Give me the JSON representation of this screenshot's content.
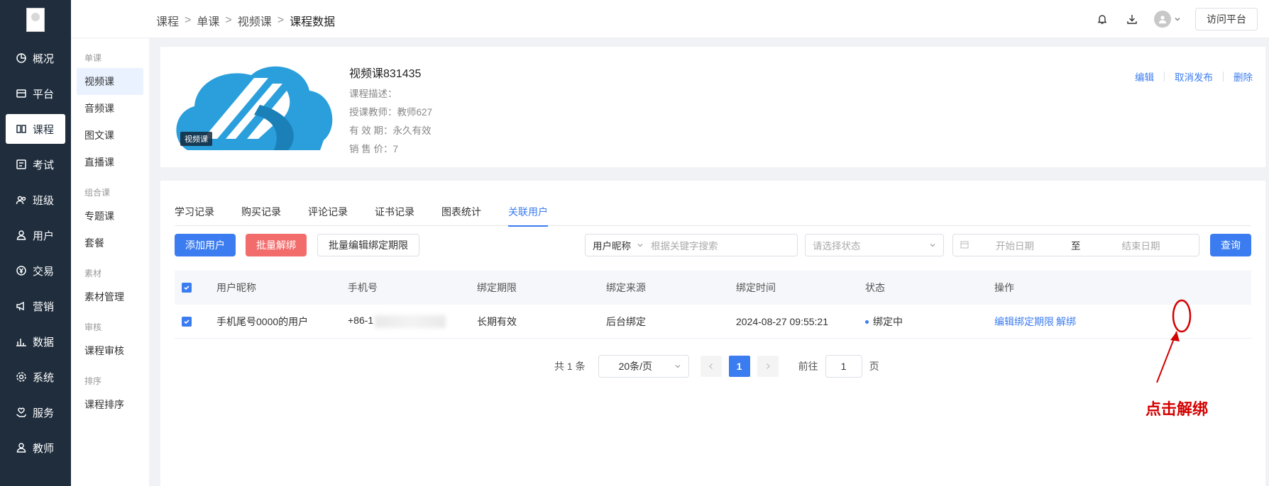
{
  "nav": {
    "items": [
      {
        "label": "概况"
      },
      {
        "label": "平台"
      },
      {
        "label": "课程"
      },
      {
        "label": "考试"
      },
      {
        "label": "班级"
      },
      {
        "label": "用户"
      },
      {
        "label": "交易"
      },
      {
        "label": "营销"
      },
      {
        "label": "数据"
      },
      {
        "label": "系统"
      },
      {
        "label": "服务"
      },
      {
        "label": "教师"
      }
    ]
  },
  "subnav": {
    "groups": [
      {
        "title": "单课",
        "items": [
          "视频课",
          "音频课",
          "图文课",
          "直播课"
        ]
      },
      {
        "title": "组合课",
        "items": [
          "专题课",
          "套餐"
        ]
      },
      {
        "title": "素材",
        "items": [
          "素材管理"
        ]
      },
      {
        "title": "审核",
        "items": [
          "课程审核"
        ]
      },
      {
        "title": "排序",
        "items": [
          "课程排序"
        ]
      }
    ]
  },
  "breadcrumb": [
    "课程",
    "单课",
    "视频课",
    "课程数据"
  ],
  "topbar": {
    "visit_label": "访问平台"
  },
  "course": {
    "cover_tag": "视频课",
    "title": "视频课831435",
    "desc": "课程描述：",
    "teacher": "授课教师：教师627",
    "validity": "有 效 期：永久有效",
    "price": "销 售 价：7",
    "actions": {
      "edit": "编辑",
      "unpublish": "取消发布",
      "delete": "删除"
    }
  },
  "tabs": [
    "学习记录",
    "购买记录",
    "评论记录",
    "证书记录",
    "图表统计",
    "关联用户"
  ],
  "toolbar": {
    "add_user": "添加用户",
    "batch_unbind": "批量解绑",
    "batch_edit_period": "批量编辑绑定期限",
    "search_field": "用户昵称",
    "search_placeholder": "根据关键字搜索",
    "status_placeholder": "请选择状态",
    "start_date": "开始日期",
    "date_sep": "至",
    "end_date": "结束日期",
    "query": "查询"
  },
  "table": {
    "headers": [
      "用户昵称",
      "手机号",
      "绑定期限",
      "绑定来源",
      "绑定时间",
      "状态",
      "操作"
    ],
    "rows": [
      {
        "nickname": "手机尾号0000的用户",
        "phone": "+86-1",
        "period": "长期有效",
        "source": "后台绑定",
        "time": "2024-08-27 09:55:21",
        "status": "绑定中",
        "op_edit": "编辑绑定期限",
        "op_unbind": "解绑"
      }
    ]
  },
  "pager": {
    "total": "共 1 条",
    "page_size": "20条/页",
    "current": "1",
    "goto_label": "前往",
    "goto_value": "1",
    "page_unit": "页"
  },
  "annotation": {
    "text": "点击解绑",
    "color": "#d40000"
  },
  "colors": {
    "accent": "#3b7cf0",
    "danger": "#f36c6c",
    "nav_bg": "#1f2d3d"
  }
}
